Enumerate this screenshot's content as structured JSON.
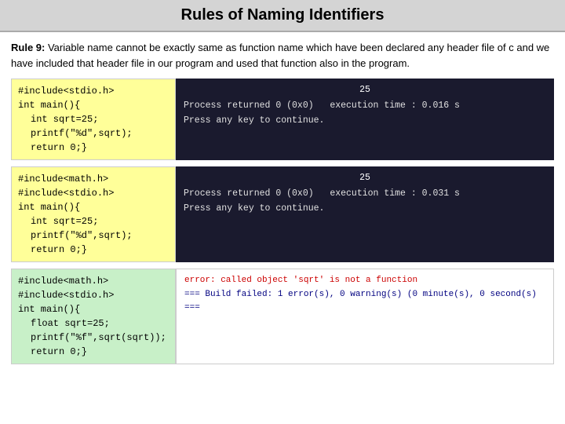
{
  "title": "Rules of Naming Identifiers",
  "rule": {
    "label": "Rule 9:",
    "text": " Variable name cannot be exactly same as function name which have been declared any header file of c and we have included that header file in our program and used that function also in the program."
  },
  "examples": [
    {
      "code_lines": [
        "#include<stdio.h>",
        "int main(){",
        "    int sqrt=25;",
        "    printf(\"%d\",sqrt);",
        "    return 0;}"
      ],
      "output_number": "25",
      "output_lines": [
        "Process returned 0 (0x0)   execution time : 0.016 s",
        "Press any key to continue."
      ],
      "type": "success"
    },
    {
      "code_lines": [
        "#include<math.h>",
        "#include<stdio.h>",
        "int main(){",
        "    int sqrt=25;",
        "    printf(\"%d\",sqrt);",
        "    return 0;}"
      ],
      "output_number": "25",
      "output_lines": [
        "Process returned 0 (0x0)   execution time : 0.031 s",
        "Press any key to continue."
      ],
      "type": "success"
    },
    {
      "code_lines": [
        "#include<math.h>",
        "#include<stdio.h>",
        "int main(){",
        "    float sqrt=25;",
        "    printf(\"%f\",sqrt(sqrt));",
        "    return 0;}"
      ],
      "error_lines": [
        "error: called object 'sqrt' is not a function",
        "=== Build failed: 1 error(s), 0 warning(s) (0 minute(s), 0 second(s) ==="
      ],
      "type": "error"
    }
  ]
}
